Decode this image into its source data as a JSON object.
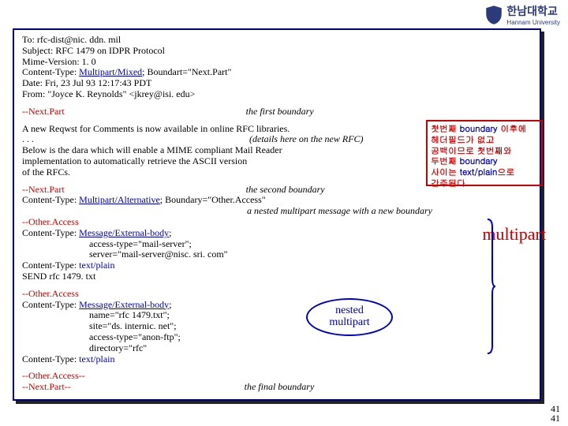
{
  "university": {
    "korean": "한남대학교",
    "english": "Hannam University"
  },
  "header": {
    "to_label": "To: ",
    "to_value": "rfc-dist@nic. ddn. mil",
    "subject_label": "Subject: ",
    "subject_value": "RFC 1479 on IDPR Protocol",
    "mime_label": "Mime-Version: ",
    "mime_value": "1. 0",
    "ct_label": "Content-Type: ",
    "ct_value": "Multipart/Mixed",
    "ct_suffix": "; Boundart=\"Next.Part\"",
    "date_label": "Date: ",
    "date_value": "Fri, 23 Jul 93 12:17:43 PDT",
    "from_label": "From: ",
    "from_value": "\"Joyce K. Reynolds\" <jkrey@isi. edu>"
  },
  "b1": {
    "marker": "--Next.Part",
    "note": "the first boundary"
  },
  "body1": {
    "l1": "A new Reqwst for Comments is now available in online RFC libraries.",
    "l2": ". . .",
    "l2r": "(details here on the new RFC)",
    "l3": "Below is the dara which will enable a MIME compliant Mail Reader",
    "l4": "implementation to automatically retrieve the ASCII version",
    "l5": "of the RFCs."
  },
  "b2": {
    "marker": "--Next.Part",
    "note": "the second boundary",
    "ct_label": "Content-Type: ",
    "ct_value": "Multipart/Alternative",
    "ct_suffix": "; Boundary=\"Other.Access\"",
    "note2": "a nested multipart message with a new boundary"
  },
  "oa1": {
    "marker": "--Other.Access",
    "ct1_label": "Content-Type: ",
    "ct1_value": "Message/External-body",
    "a1": "access-type=\"mail-server\";",
    "a2": "server=\"mail-server@nisc. sri. com\"",
    "ct2_label": "Content-Type: ",
    "ct2_value": "text/plain",
    "send": "SEND rfc 1479. txt"
  },
  "oa2": {
    "marker": "--Other.Access",
    "ct1_label": "Content-Type: ",
    "ct1_value": "Message/External-body",
    "a1": "name=\"rfc 1479.txt\";",
    "a2": "site=\"ds. internic. net\";",
    "a3": "access-type=\"anon-ftp\";",
    "a4": "directory=\"rfc\"",
    "ct2_label": "Content-Type: ",
    "ct2_value": "text/plain"
  },
  "final": {
    "m1": "--Other.Access--",
    "m2": "--Next.Part--",
    "note": "the final boundary"
  },
  "annot": {
    "l1a": "첫번째 ",
    "l1b": "boundary ",
    "l1c": "이후에",
    "l2": "헤더필드가 없고",
    "l3": "공백이므로 첫번째와",
    "l4a": "두번째 ",
    "l4b": "boundary",
    "l5a": "사이는 ",
    "l5b": "text/plain",
    "l5c": "으로",
    "l6": "간주된다."
  },
  "multipart_label": "multipart",
  "nested": {
    "l1": "nested",
    "l2": "multipart"
  },
  "page": "41"
}
